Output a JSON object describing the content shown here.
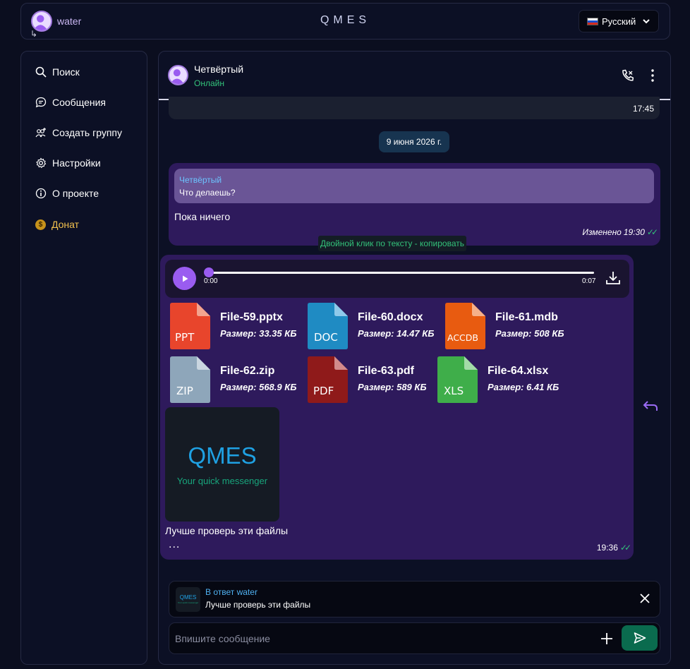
{
  "app": {
    "brand": "QMES"
  },
  "user": {
    "name": "water",
    "logout_glyph": "↳"
  },
  "language": {
    "selected": "Русский"
  },
  "sidebar": {
    "items": [
      {
        "label": "Поиск",
        "icon": "search-icon"
      },
      {
        "label": "Сообщения",
        "icon": "messages-icon"
      },
      {
        "label": "Создать группу",
        "icon": "add-group-icon"
      },
      {
        "label": "Настройки",
        "icon": "gear-icon"
      },
      {
        "label": "О проекте",
        "icon": "info-icon"
      },
      {
        "label": "Донат",
        "icon": "coin-icon",
        "coin_glyph": "$"
      }
    ]
  },
  "chat": {
    "name": "Четвёртый",
    "status": "Онлайн",
    "previous_time": "17:45",
    "date_separator": "9 июня 2026 г.",
    "message1": {
      "quote_name": "Четвёртый",
      "quote_text": "Что делаешь?",
      "text": "Пока ничего",
      "edited_label": "Изменено",
      "time": "19:30",
      "check": "✓✓"
    },
    "tooltip": "Двойной клик по тексту - копировать",
    "message2": {
      "audio": {
        "current": "0:00",
        "duration": "0:07",
        "progress": 0
      },
      "files": [
        {
          "name": "File-59.pptx",
          "size": "Размер: 33.35 КБ",
          "label": "PPT",
          "color": "#e8452c"
        },
        {
          "name": "File-60.docx",
          "size": "Размер: 14.47 КБ",
          "label": "DOC",
          "color": "#1f8bc3"
        },
        {
          "name": "File-61.mdb",
          "size": "Размер: 508 КБ",
          "label": "ACCDB",
          "color": "#e85b10"
        },
        {
          "name": "File-62.zip",
          "size": "Размер: 568.9 КБ",
          "label": "ZIP",
          "color": "#8ea6ba"
        },
        {
          "name": "File-63.pdf",
          "size": "Размер: 589 КБ",
          "label": "PDF",
          "color": "#8f1a1a"
        },
        {
          "name": "File-64.xlsx",
          "size": "Размер: 6.41 КБ",
          "label": "XLS",
          "color": "#3fae4a"
        }
      ],
      "image_title": "QMES",
      "image_subtitle": "Your quick messenger",
      "text": "Лучше проверь эти файлы",
      "more": "...",
      "time": "19:36",
      "check": "✓✓"
    }
  },
  "reply": {
    "label": "В ответ water",
    "text": "Лучше проверь эти файлы",
    "thumb_title": "QMES",
    "thumb_subtitle": "Your quick messenger"
  },
  "compose": {
    "placeholder": "Впишите сообщение"
  },
  "colors": {
    "accent": "#9a5cf0",
    "bubble": "#2e1a5c",
    "online": "#33c27a",
    "send": "#0a6b4e"
  }
}
